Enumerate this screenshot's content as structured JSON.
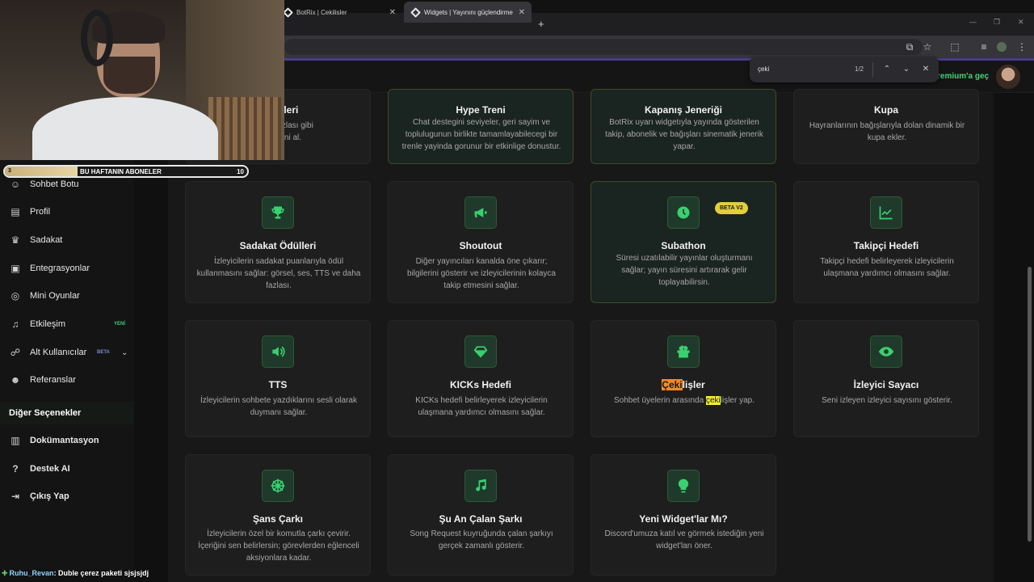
{
  "browser": {
    "tabs": [
      {
        "title": "BotRix | Cekilisler"
      },
      {
        "title": "Widgets | Yayınını güçlendirme"
      }
    ]
  },
  "find_bar": {
    "query": "çeki",
    "count": "1/2"
  },
  "header": {
    "premium_label": "remium'a geç"
  },
  "subs_widget": {
    "label": "BU HAFTANIN ABONELER",
    "current": "3",
    "goal": "10",
    "progress": 0.3
  },
  "chat_message": {
    "user": "Ruhu_Revan",
    "text": ": Duble çerez paketi sjsjsjdj"
  },
  "sidebar": {
    "items": [
      {
        "label": "Sohbet Botu",
        "icon": "robot-icon"
      },
      {
        "label": "Profil",
        "icon": "id-card-icon"
      },
      {
        "label": "Sadakat",
        "icon": "trophy-icon"
      },
      {
        "label": "Entegrasyonlar",
        "icon": "plug-icon"
      },
      {
        "label": "Mini Oyunlar",
        "icon": "gamepad-icon"
      },
      {
        "label": "Etkileşim",
        "icon": "music-icon",
        "badge": "YENİ"
      },
      {
        "label": "Alt Kullanıcılar",
        "icon": "users-icon",
        "badge": "BETA"
      },
      {
        "label": "Referanslar",
        "icon": "user-group-icon"
      }
    ],
    "section_title": "Diğer Seçenekler",
    "other_items": [
      {
        "label": "Dokümantasyon",
        "icon": "book-icon"
      },
      {
        "label": "Destek AI",
        "icon": "question-icon"
      },
      {
        "label": "Çıkış Yap",
        "icon": "logout-icon"
      }
    ]
  },
  "cards": {
    "row0": [
      {
        "title": "Etiketleri",
        "desc_l1": "ve daha fazlası gibi",
        "desc_l2": "in metnini al."
      },
      {
        "title": "Hype Treni",
        "desc_l1": "Chat destegini seviyeler, geri sayim ve",
        "desc_l2": "toplulugunun birlikte tamamlayabilecegi bir",
        "desc_l3": "trenle yayinda gorunur bir etkinlige donustur."
      },
      {
        "title": "Kapanış Jeneriği",
        "desc_l1": "BotRix uyarı widgetıyla yayında gösterilen",
        "desc_l2": "takip, abonelik ve bağışları sinematik jenerik",
        "desc_l3": "yapar."
      },
      {
        "title": "Kupa",
        "desc_l1": "Hayranlarının bağışlarıyla dolan dinamik bir",
        "desc_l2": "kupa ekler."
      }
    ],
    "row1": [
      {
        "title": "Sadakat Ödülleri",
        "icon": "trophy-icon",
        "desc_l1": "İzleyicilerin sadakat puanlarıyla ödül",
        "desc_l2": "kullanmasını sağlar: görsel, ses, TTS ve daha",
        "desc_l3": "fazlası."
      },
      {
        "title": "Shoutout",
        "icon": "megaphone-icon",
        "desc_l1": "Diğer yayıncıları kanalda öne çıkarır;",
        "desc_l2": "bilgilerini gösterir ve izleyicilerinin kolayca",
        "desc_l3": "takip etmesini sağlar."
      },
      {
        "title": "Subathon",
        "icon": "clock-icon",
        "badge": "BETA V2",
        "desc_l1": "Süresi uzatılabilir yayınlar oluşturmanı",
        "desc_l2": "sağlar; yayın süresini artırarak gelir",
        "desc_l3": "toplayabilirsin."
      },
      {
        "title": "Takipçi Hedefi",
        "icon": "chart-icon",
        "desc_l1": "Takipçi hedefi belirleyerek izleyicilerin",
        "desc_l2": "ulaşmana yardımcı olmasını sağlar."
      }
    ],
    "row2": [
      {
        "title": "TTS",
        "icon": "speaker-icon",
        "desc_l1": "İzleyicilerin sohbete yazdıklarını sesli olarak",
        "desc_l2": "duymanı sağlar."
      },
      {
        "title": "KICKs Hedefi",
        "icon": "gem-icon",
        "desc_l1": "KICKs hedefi belirleyerek izleyicilerin",
        "desc_l2": "ulaşmana yardımcı olmasını sağlar."
      },
      {
        "title_mark": "Çeki",
        "title_rest": "lişler",
        "icon": "gift-icon",
        "desc_pre": "Sohbet üyelerin arasında ",
        "desc_mark": "çeki",
        "desc_post": "lişler yap."
      },
      {
        "title": "İzleyici Sayacı",
        "icon": "eye-icon",
        "desc_l1": "Seni izleyen izleyici sayısını gösterir."
      }
    ],
    "row3": [
      {
        "title": "Şans Çarkı",
        "icon": "wheel-icon",
        "desc_l1": "İzleyicilerin özel bir komutla çarkı çevirir.",
        "desc_l2": "İçeriğini sen belirlersin; görevlerden eğlenceli",
        "desc_l3": "aksiyonlara kadar."
      },
      {
        "title": "Şu An Çalan Şarkı",
        "icon": "music-icon",
        "desc_l1": "Song Request kuyruğunda çalan şarkıyı",
        "desc_l2": "gerçek zamanlı gösterir."
      },
      {
        "title": "Yeni Widget'lar Mı?",
        "icon": "bulb-icon",
        "desc_l1": "Discord'umuza katıl ve görmek istediğin yeni",
        "desc_l2": "widget'ları öner."
      }
    ]
  },
  "colors": {
    "accent_green": "#46d37a",
    "find_current": "#f08a2e",
    "find_match": "#f4f02e",
    "beta_badge": "#e2cf3a"
  }
}
